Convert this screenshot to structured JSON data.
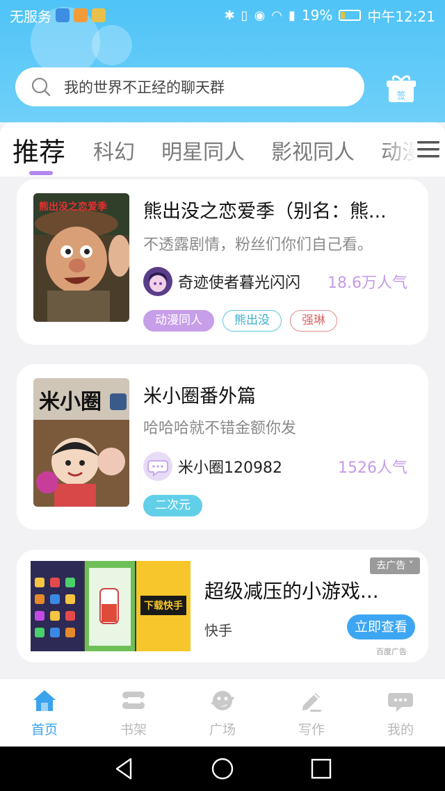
{
  "status_bar": {
    "carrier": "无服务",
    "battery": "19%",
    "time": "中午12:21"
  },
  "search": {
    "placeholder": "我的世界不正经的聊天群",
    "gift_label": "签"
  },
  "tabs": [
    {
      "label": "推荐",
      "active": true
    },
    {
      "label": "科幻",
      "active": false
    },
    {
      "label": "明星同人",
      "active": false
    },
    {
      "label": "影视同人",
      "active": false
    },
    {
      "label": "动漫",
      "active": false
    }
  ],
  "cards": [
    {
      "title": "熊出没之恋爱季（别名：熊...",
      "desc": "不透露剧情，粉丝们你们自己看。",
      "author": "奇迹使者暮光闪闪",
      "popularity": "18.6万人气",
      "cover_text": "熊出没之恋爱季",
      "tags": [
        "动漫同人",
        "熊出没",
        "强琳"
      ]
    },
    {
      "title": "米小圈番外篇",
      "desc": "哈哈哈就不错金额你发",
      "author": "米小圈120982",
      "popularity": "1526人气",
      "cover_text": "米小圈",
      "tags": [
        "二次元"
      ]
    }
  ],
  "ad": {
    "title": "超级减压的小游戏...",
    "source": "快手",
    "button": "立即查看",
    "close_label": "去广告",
    "mark": "百度广告",
    "image_text": "下载快手"
  },
  "bottom_nav": [
    {
      "label": "首页",
      "active": true
    },
    {
      "label": "书架",
      "active": false
    },
    {
      "label": "广场",
      "active": false
    },
    {
      "label": "写作",
      "active": false
    },
    {
      "label": "我的",
      "active": false
    }
  ],
  "colors": {
    "header": "#4fc3f7",
    "accent_purple": "#b388ee",
    "popularity": "#c59be8",
    "nav_active": "#3aa3ee"
  }
}
